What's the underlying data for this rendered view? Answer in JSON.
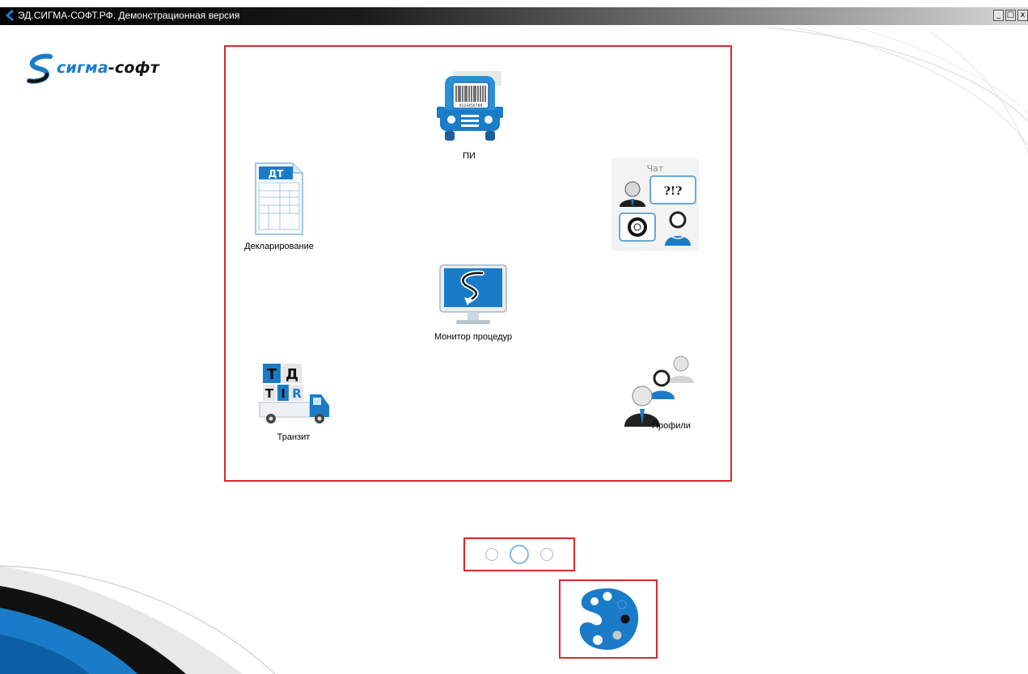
{
  "window": {
    "title": "ЭД.СИГМА-СОФТ.РФ. Демонстрационная версия",
    "minimize_label": "_",
    "maximize_label": "□",
    "close_label": "x"
  },
  "logo": {
    "part1": "сигма",
    "dash": "-",
    "part2": "софт"
  },
  "tiles": {
    "pi": {
      "label": "ПИ",
      "barcode_digits": "0123456789"
    },
    "declaration": {
      "label": "Декларирование",
      "doc_tag": "ДТ"
    },
    "chat": {
      "label": "Чат",
      "bubble": "?!?"
    },
    "monitor": {
      "label": "Монитор процедур"
    },
    "transit": {
      "label": "Транзит",
      "letters": [
        "Т",
        "Д",
        "T",
        "I",
        "R"
      ]
    },
    "profiles": {
      "label": "Профили"
    }
  },
  "pager": {
    "pages": 3,
    "current": 2
  },
  "colors": {
    "accent": "#1a7cc8",
    "highlight_border": "#d9292b"
  }
}
